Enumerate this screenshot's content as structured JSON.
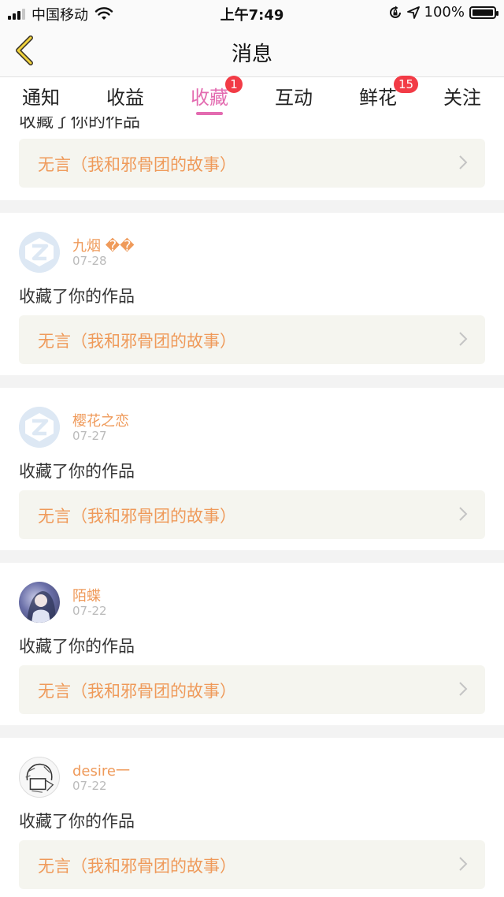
{
  "status_bar": {
    "carrier": "中国移动",
    "time": "上午7:49",
    "battery": "100%",
    "signal_bars_filled": 3,
    "icons": [
      "signal-icon",
      "wifi-icon",
      "rotation-lock-icon",
      "location-arrow-icon",
      "battery-icon"
    ]
  },
  "nav": {
    "title": "消息",
    "back_icon": "chevron-left-icon"
  },
  "tabs": [
    {
      "label": "通知",
      "badge": ""
    },
    {
      "label": "收益",
      "badge": ""
    },
    {
      "label": "收藏",
      "badge": "1",
      "active": true
    },
    {
      "label": "互动",
      "badge": ""
    },
    {
      "label": "鲜花",
      "badge": "15"
    },
    {
      "label": "关注",
      "badge": ""
    }
  ],
  "colors": {
    "accent_pink": "#e36bb0",
    "badge_red": "#f23b46",
    "username_orange": "#ef9a5a",
    "work_box_bg": "#f5f5ef"
  },
  "feed": {
    "partial_top": {
      "action": "收藏了你的作品",
      "work_title": "无言（我和邪骨团的故事）"
    },
    "items": [
      {
        "username": "九烟 ��",
        "date": "07-28",
        "action": "收藏了你的作品",
        "work_title": "无言（我和邪骨团的故事）",
        "avatar": "default-avatar"
      },
      {
        "username": "樱花之恋",
        "date": "07-27",
        "action": "收藏了你的作品",
        "work_title": "无言（我和邪骨团的故事）",
        "avatar": "default-avatar"
      },
      {
        "username": "陌蝶",
        "date": "07-22",
        "action": "收藏了你的作品",
        "work_title": "无言（我和邪骨团的故事）",
        "avatar": "photo-avatar"
      },
      {
        "username": "desire一",
        "date": "07-22",
        "action": "收藏了你的作品",
        "work_title": "无言（我和邪骨团的故事）",
        "avatar": "sketch-avatar"
      }
    ]
  }
}
